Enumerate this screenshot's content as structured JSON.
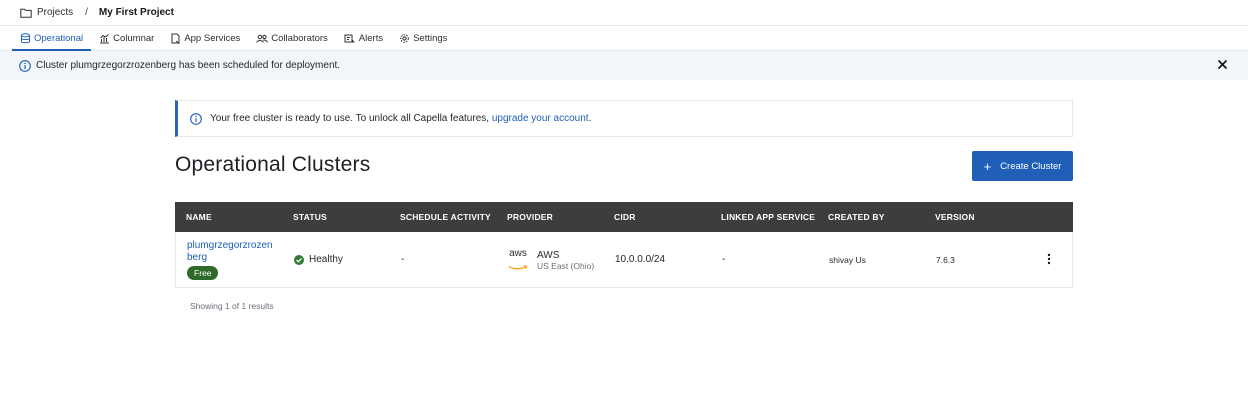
{
  "breadcrumb": {
    "projects_label": "Projects",
    "separator": "/",
    "current": "My First Project"
  },
  "tabs": [
    {
      "label": "Operational",
      "icon": "database-icon",
      "active": true
    },
    {
      "label": "Columnar",
      "icon": "columnar-chart-icon",
      "active": false
    },
    {
      "label": "App Services",
      "icon": "app-services-icon",
      "active": false
    },
    {
      "label": "Collaborators",
      "icon": "users-icon",
      "active": false
    },
    {
      "label": "Alerts",
      "icon": "alerts-icon",
      "active": false
    },
    {
      "label": "Settings",
      "icon": "gear-icon",
      "active": false
    }
  ],
  "notification": {
    "message": "Cluster plumgrzegorzrozenberg has been scheduled for deployment.",
    "icon": "info-icon"
  },
  "banner": {
    "text_prefix": "Your free cluster is ready to use. To unlock all Capella features, ",
    "link_text": "upgrade your account",
    "text_suffix": "."
  },
  "page": {
    "title": "Operational Clusters",
    "create_button": "Create Cluster"
  },
  "table": {
    "headers": [
      "NAME",
      "STATUS",
      "SCHEDULE ACTIVITY",
      "PROVIDER",
      "CIDR",
      "LINKED APP SERVICE",
      "CREATED BY",
      "VERSION"
    ],
    "rows": [
      {
        "name": "plumgrzegorzrozenberg",
        "badge": "Free",
        "status": "Healthy",
        "schedule_activity": "-",
        "provider_logo": "aws",
        "provider": "AWS",
        "region": "US East (Ohio)",
        "cidr": "10.0.0.0/24",
        "linked_app_service": "-",
        "created_by": "shivay Us",
        "version": "7.6.3"
      }
    ],
    "results_text": "Showing 1 of 1 results"
  },
  "colors": {
    "accent": "#1f5fb8",
    "header_bg": "#3d3d3d",
    "healthy": "#2f7d32",
    "free_badge": "#2f6a2b"
  }
}
